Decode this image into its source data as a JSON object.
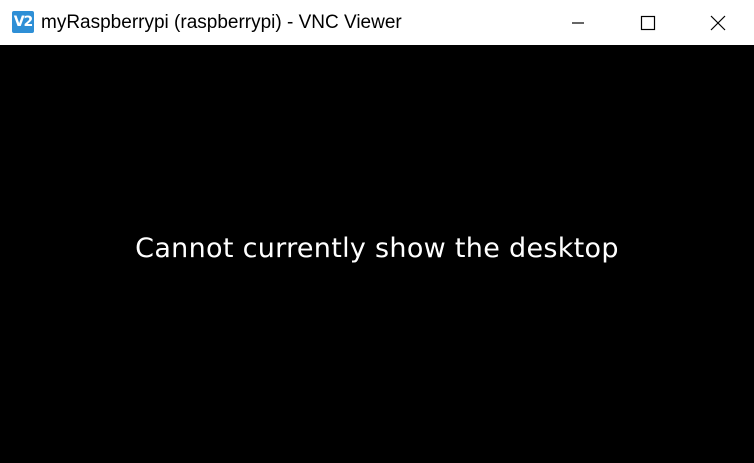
{
  "window": {
    "title": "myRaspberrypi (raspberrypi) - VNC Viewer",
    "app_icon_text": "V2",
    "controls": {
      "minimize": "minimize-icon",
      "maximize": "maximize-icon",
      "close": "close-icon"
    }
  },
  "viewer": {
    "message": "Cannot currently show the desktop",
    "background": "#000000",
    "text_color": "#ffffff"
  },
  "colors": {
    "titlebar": "#ffffff",
    "icon_accent": "#2e8fd6"
  }
}
